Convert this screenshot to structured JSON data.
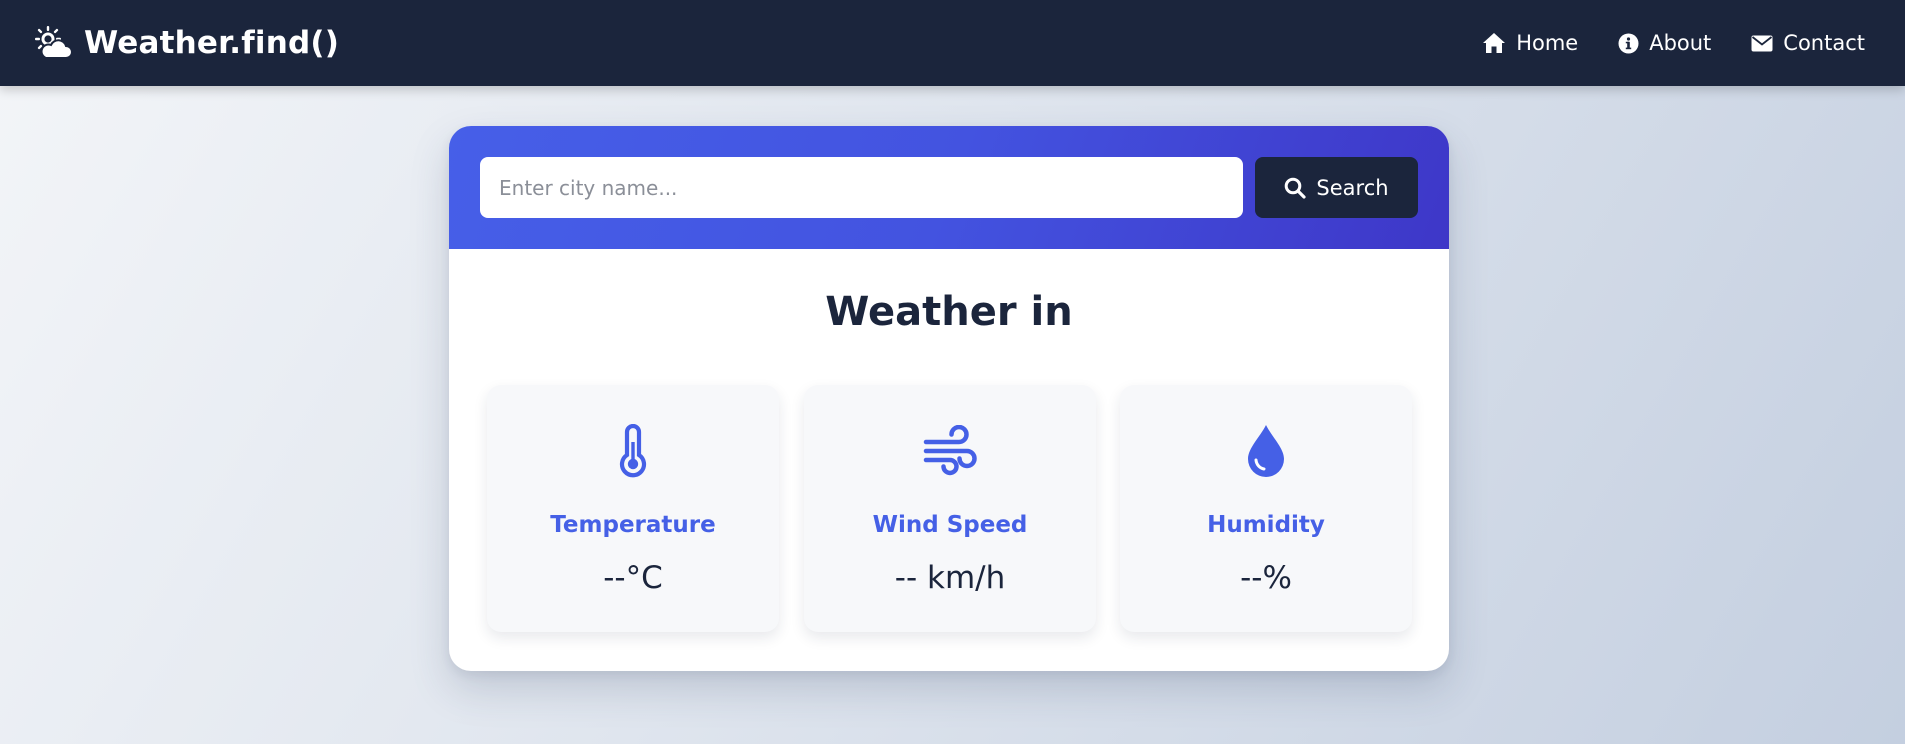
{
  "navbar": {
    "brand": "Weather.find()",
    "brand_icon": "cloud-sun-icon",
    "links": [
      {
        "label": "Home",
        "icon": "home-icon"
      },
      {
        "label": "About",
        "icon": "info-icon"
      },
      {
        "label": "Contact",
        "icon": "envelope-icon"
      }
    ]
  },
  "search": {
    "placeholder": "Enter city name...",
    "value": "",
    "button_label": "Search",
    "button_icon": "search-icon"
  },
  "weather": {
    "title": "Weather in",
    "metrics": [
      {
        "label": "Temperature",
        "value": "--°C",
        "icon": "thermometer-icon"
      },
      {
        "label": "Wind Speed",
        "value": "-- km/h",
        "icon": "wind-icon"
      },
      {
        "label": "Humidity",
        "value": "--%",
        "icon": "droplet-icon"
      }
    ]
  },
  "colors": {
    "navbar_bg": "#1b253c",
    "accent": "#4560e6",
    "search_gradient_start": "#465fe8",
    "search_gradient_end": "#3e37c8",
    "button_bg": "#1b253c"
  }
}
